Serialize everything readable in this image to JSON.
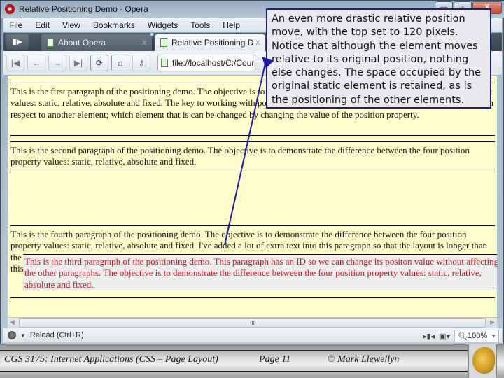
{
  "window": {
    "title": "Relative Positioning Demo - Opera",
    "controls": {
      "minimize": "—",
      "maximize": "▫",
      "close": "X"
    }
  },
  "menu": {
    "items": [
      "File",
      "Edit",
      "View",
      "Bookmarks",
      "Widgets",
      "Tools",
      "Help"
    ]
  },
  "tabs": {
    "panel_toggle_icon": "▮▶",
    "items": [
      {
        "label": "About Opera",
        "close": "x",
        "active": false
      },
      {
        "label": "Relative Positioning De...",
        "close": "x",
        "active": true
      }
    ],
    "overflow": "..."
  },
  "toolbar": {
    "buttons": [
      {
        "name": "rewind",
        "glyph": "|◀"
      },
      {
        "name": "back",
        "glyph": "←"
      },
      {
        "name": "forward",
        "glyph": "→"
      },
      {
        "name": "fast-forward",
        "glyph": "▶|"
      },
      {
        "name": "reload",
        "glyph": "⟳"
      },
      {
        "name": "home",
        "glyph": "⌂"
      },
      {
        "name": "security",
        "glyph": "⚷"
      }
    ],
    "address": "file://localhost/C:/Courses/"
  },
  "page": {
    "paragraph1": "This is the first paragraph of the positioning demo. The objective is to demonstrate the difference between the four position property values: static, relative, absolute and fixed. The key to working with positioning is understanding that each element is positioned with respect to another element; which element that is can be changed by changing the value of the position property.",
    "paragraph2": "This is the second paragraph of the positioning demo. The objective is to demonstrate the difference between the four position property values: static, relative, absolute and fixed.",
    "paragraph3": "This is the third paragraph of the positioning demo. This paragraph has an ID so we can change its positon value without affecting the other paragraphs. The objective is to demonstrate the difference between the four position property values: static, relative, absolute and fixed.",
    "paragraph4": "This is the fourth paragraph of the positioning demo. The objective is to demonstrate the difference between the four position property values: static, relative, absolute and fixed. I've added a lot of extra text into this paragraph so that the layout is longer than the browser window in the previous demos so that we can see the effect of fixed positioning with the extra text added to the end of this paragraph so the scrolling works with extra text. This is lots of extra text just to make it longer for positioning."
  },
  "scrollbar": {
    "thumb_grip": "III",
    "left_arrow": "◀",
    "right_arrow": "▶"
  },
  "status": {
    "text": "Reload (Ctrl+R)",
    "zoom": "100%"
  },
  "callout": {
    "text": "An even more drastic relative position move, with the top set to 120 pixels. Notice that although the element moves relative to its original position, nothing else changes. The space occupied by the original static element is retained, as is the positioning of the other elements."
  },
  "footer": {
    "course": "CGS 3175: Internet Applications (CSS – Page Layout)",
    "page": "Page 11",
    "author": "© Mark Llewellyn"
  },
  "colors": {
    "page_background": "#ffffcc",
    "moved_paragraph_text": "#d0101a",
    "callout_border": "#1c1c7a",
    "arrow": "#1a1aa8"
  }
}
